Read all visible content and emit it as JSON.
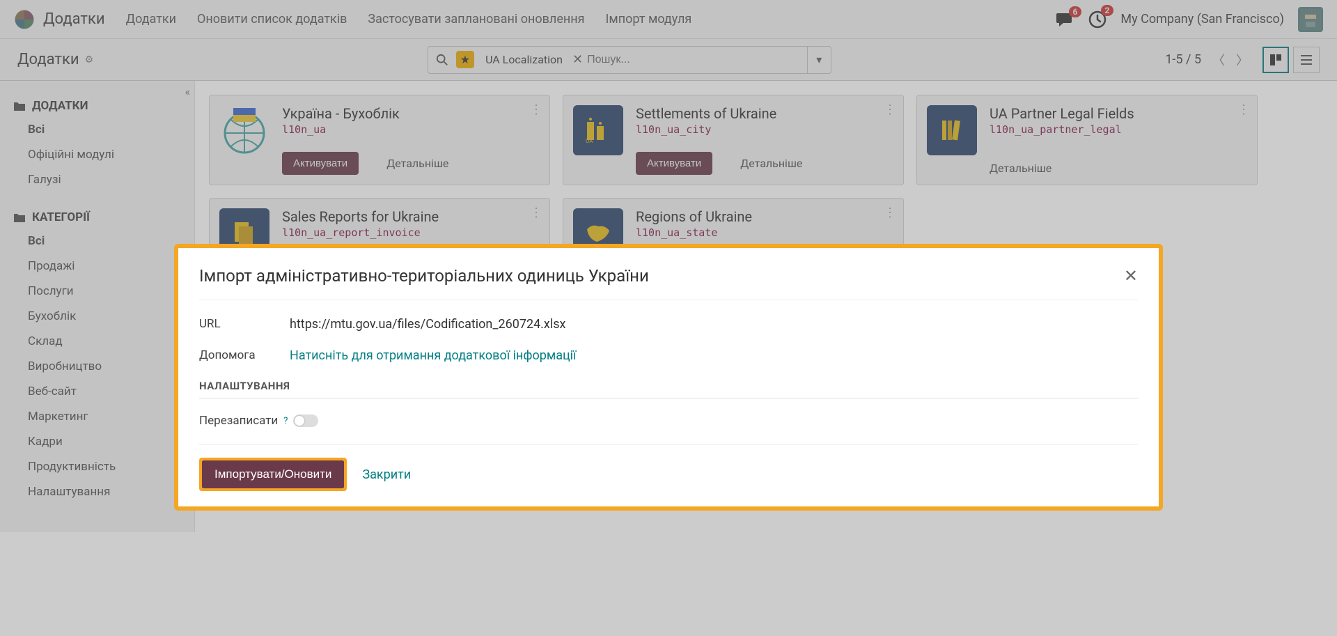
{
  "topbar": {
    "app_title": "Додатки",
    "menu": [
      "Додатки",
      "Оновити список додатків",
      "Застосувати заплановані оновлення",
      "Імпорт модуля"
    ],
    "notif_count": "6",
    "clock_count": "2",
    "company": "My Company (San Francisco)"
  },
  "controlbar": {
    "page_title": "Додатки",
    "search_tag": "UA Localization",
    "search_placeholder": "Пошук...",
    "paging": "1-5 / 5"
  },
  "sidebar": {
    "group1_title": "ДОДАТКИ",
    "group1_items": [
      "Всі",
      "Офіційні модулі",
      "Галузі"
    ],
    "group2_title": "КАТЕГОРІЇ",
    "group2_items": [
      "Всі",
      "Продажі",
      "Послуги",
      "Бухоблік",
      "Склад",
      "Виробництво",
      "Веб-сайт",
      "Маркетинг",
      "Кадри",
      "Продуктивність",
      "Налаштування"
    ]
  },
  "cards": [
    {
      "title": "Україна - Бухоблік",
      "sub": "l10n_ua",
      "activate": "Активувати",
      "details": "Детальніше",
      "icon": "globe"
    },
    {
      "title": "Settlements of Ukraine",
      "sub": "l10n_ua_city",
      "activate": "Активувати",
      "details": "Детальніше",
      "icon": "building"
    },
    {
      "title": "UA Partner Legal Fields",
      "sub": "l10n_ua_partner_legal",
      "activate": "",
      "details": "Детальніше",
      "icon": "books"
    },
    {
      "title": "Sales Reports for Ukraine",
      "sub": "l10n_ua_report_invoice",
      "activate": "",
      "details": "",
      "icon": "doc"
    },
    {
      "title": "Regions of Ukraine",
      "sub": "l10n_ua_state",
      "activate": "",
      "details": "",
      "icon": "map"
    }
  ],
  "modal": {
    "title": "Імпорт адміністративно-територіальних одиниць України",
    "url_label": "URL",
    "url_value": "https://mtu.gov.ua/files/Codification_260724.xlsx",
    "help_label": "Допомога",
    "help_link": "Натисніть для отримання додаткової інформації",
    "section": "НАЛАШТУВАННЯ",
    "overwrite_label": "Перезаписати",
    "help_mark": "?",
    "import_btn": "Імпортувати/Оновити",
    "close_btn": "Закрити"
  }
}
